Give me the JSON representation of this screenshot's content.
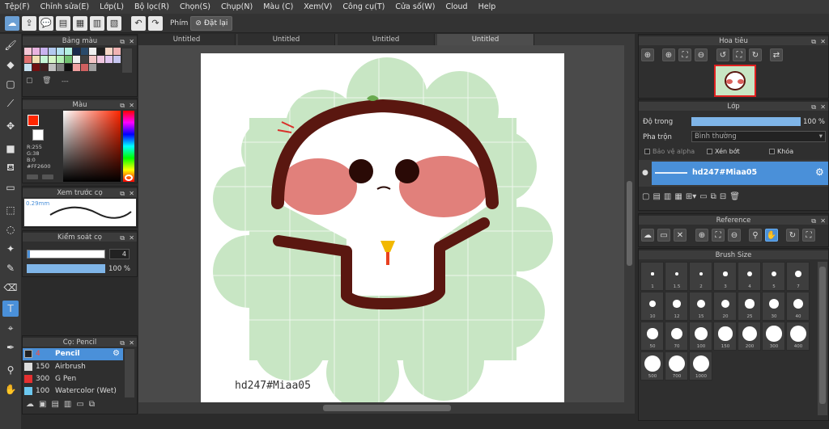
{
  "menu": [
    "Tệp(F)",
    "Chỉnh sửa(E)",
    "Lớp(L)",
    "Bộ lọc(R)",
    "Chọn(S)",
    "Chụp(N)",
    "Màu (C)",
    "Xem(V)",
    "Công cụ(T)",
    "Cửa số(W)",
    "Cloud",
    "Help"
  ],
  "toolbar": {
    "snap_label": "Phím",
    "reset_label": "Đặt lại"
  },
  "panels": {
    "palette": {
      "title": "Bảng màu",
      "footer": "---"
    },
    "color": {
      "title": "Màu",
      "r": "R:255",
      "g": "G:38",
      "b": "B:0",
      "hex": "#FF2600"
    },
    "brush_preview": {
      "title": "Xem trước cọ",
      "size_label": "0.29mm"
    },
    "brush_control": {
      "title": "Kiểm soát cọ",
      "size_value": "4",
      "opacity_value": "100 %"
    },
    "brush_list": {
      "title": "Cọ: Pencil",
      "items": [
        {
          "size": "4",
          "name": "Pencil",
          "selected": true
        },
        {
          "size": "150",
          "name": "Airbrush",
          "selected": false
        },
        {
          "size": "300",
          "name": "G Pen",
          "selected": false
        },
        {
          "size": "100",
          "name": "Watercolor (Wet)",
          "selected": false
        }
      ]
    },
    "navigator": {
      "title": "Hoa tiêu"
    },
    "layer": {
      "title": "Lớp",
      "opacity_label": "Độ trong",
      "opacity_value": "100 %",
      "blend_label": "Pha trộn",
      "blend_value": "Bình thường",
      "protect_alpha": "Bảo vệ alpha",
      "clipping": "Xén bớt",
      "lock": "Khóa",
      "layer_name": "hd247#Miaa05"
    },
    "reference": {
      "title": "Reference"
    },
    "brush_size": {
      "title": "Brush Size",
      "sizes": [
        "1",
        "1.5",
        "2",
        "3",
        "4",
        "5",
        "7",
        "10",
        "12",
        "15",
        "20",
        "25",
        "30",
        "40",
        "50",
        "70",
        "100",
        "150",
        "200",
        "300",
        "400",
        "500",
        "700",
        "1000"
      ]
    }
  },
  "tabs": [
    "Untitled",
    "Untitled",
    "Untitled",
    "Untitled"
  ],
  "canvas": {
    "watermark": "hd247#Miaa05"
  },
  "colors": {
    "accent": "#4a90d9",
    "foreground": "#FF2600",
    "background": "#ffffff"
  }
}
